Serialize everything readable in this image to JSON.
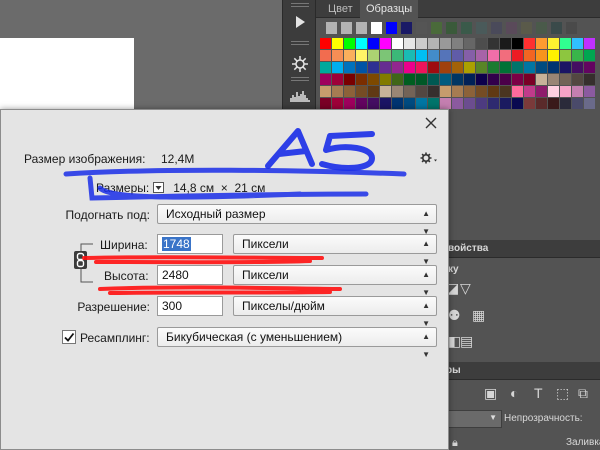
{
  "panels": {
    "swatch_tabs": [
      {
        "label": "Цвет",
        "active": false
      },
      {
        "label": "Образцы",
        "active": true
      }
    ],
    "props_tab_partial": "войства",
    "props_label_partial": "ку",
    "layers_tab_partial": "ры",
    "opacity_label": "Непрозрачность:",
    "fill_label_partial": "Заливка:"
  },
  "dialog": {
    "image_size_label": "Размер изображения:",
    "image_size_value": "12,4M",
    "dimensions_label": "Размеры:",
    "dimensions_value": "14,8 см  ×  21 см",
    "fit_to_label": "Подогнать под:",
    "fit_to_value": "Исходный размер",
    "width_label": "Ширина:",
    "width_value": "1748",
    "width_unit": "Пиксели",
    "height_label": "Высота:",
    "height_value": "2480",
    "height_unit": "Пиксели",
    "resolution_label": "Разрешение:",
    "resolution_value": "300",
    "resolution_unit": "Пикселы/дюйм",
    "resample_label": "Ресамплинг:",
    "resample_checked": true,
    "resample_value": "Бикубическая (с уменьшением)"
  },
  "annotation": {
    "handwritten_text": "A5",
    "color_blue": "#1a2ee8",
    "color_red": "#ff1010"
  },
  "colors": {
    "dialog_bg": "#e4e4e4",
    "selection": "#3a74c8",
    "panel_bg": "#535353"
  }
}
